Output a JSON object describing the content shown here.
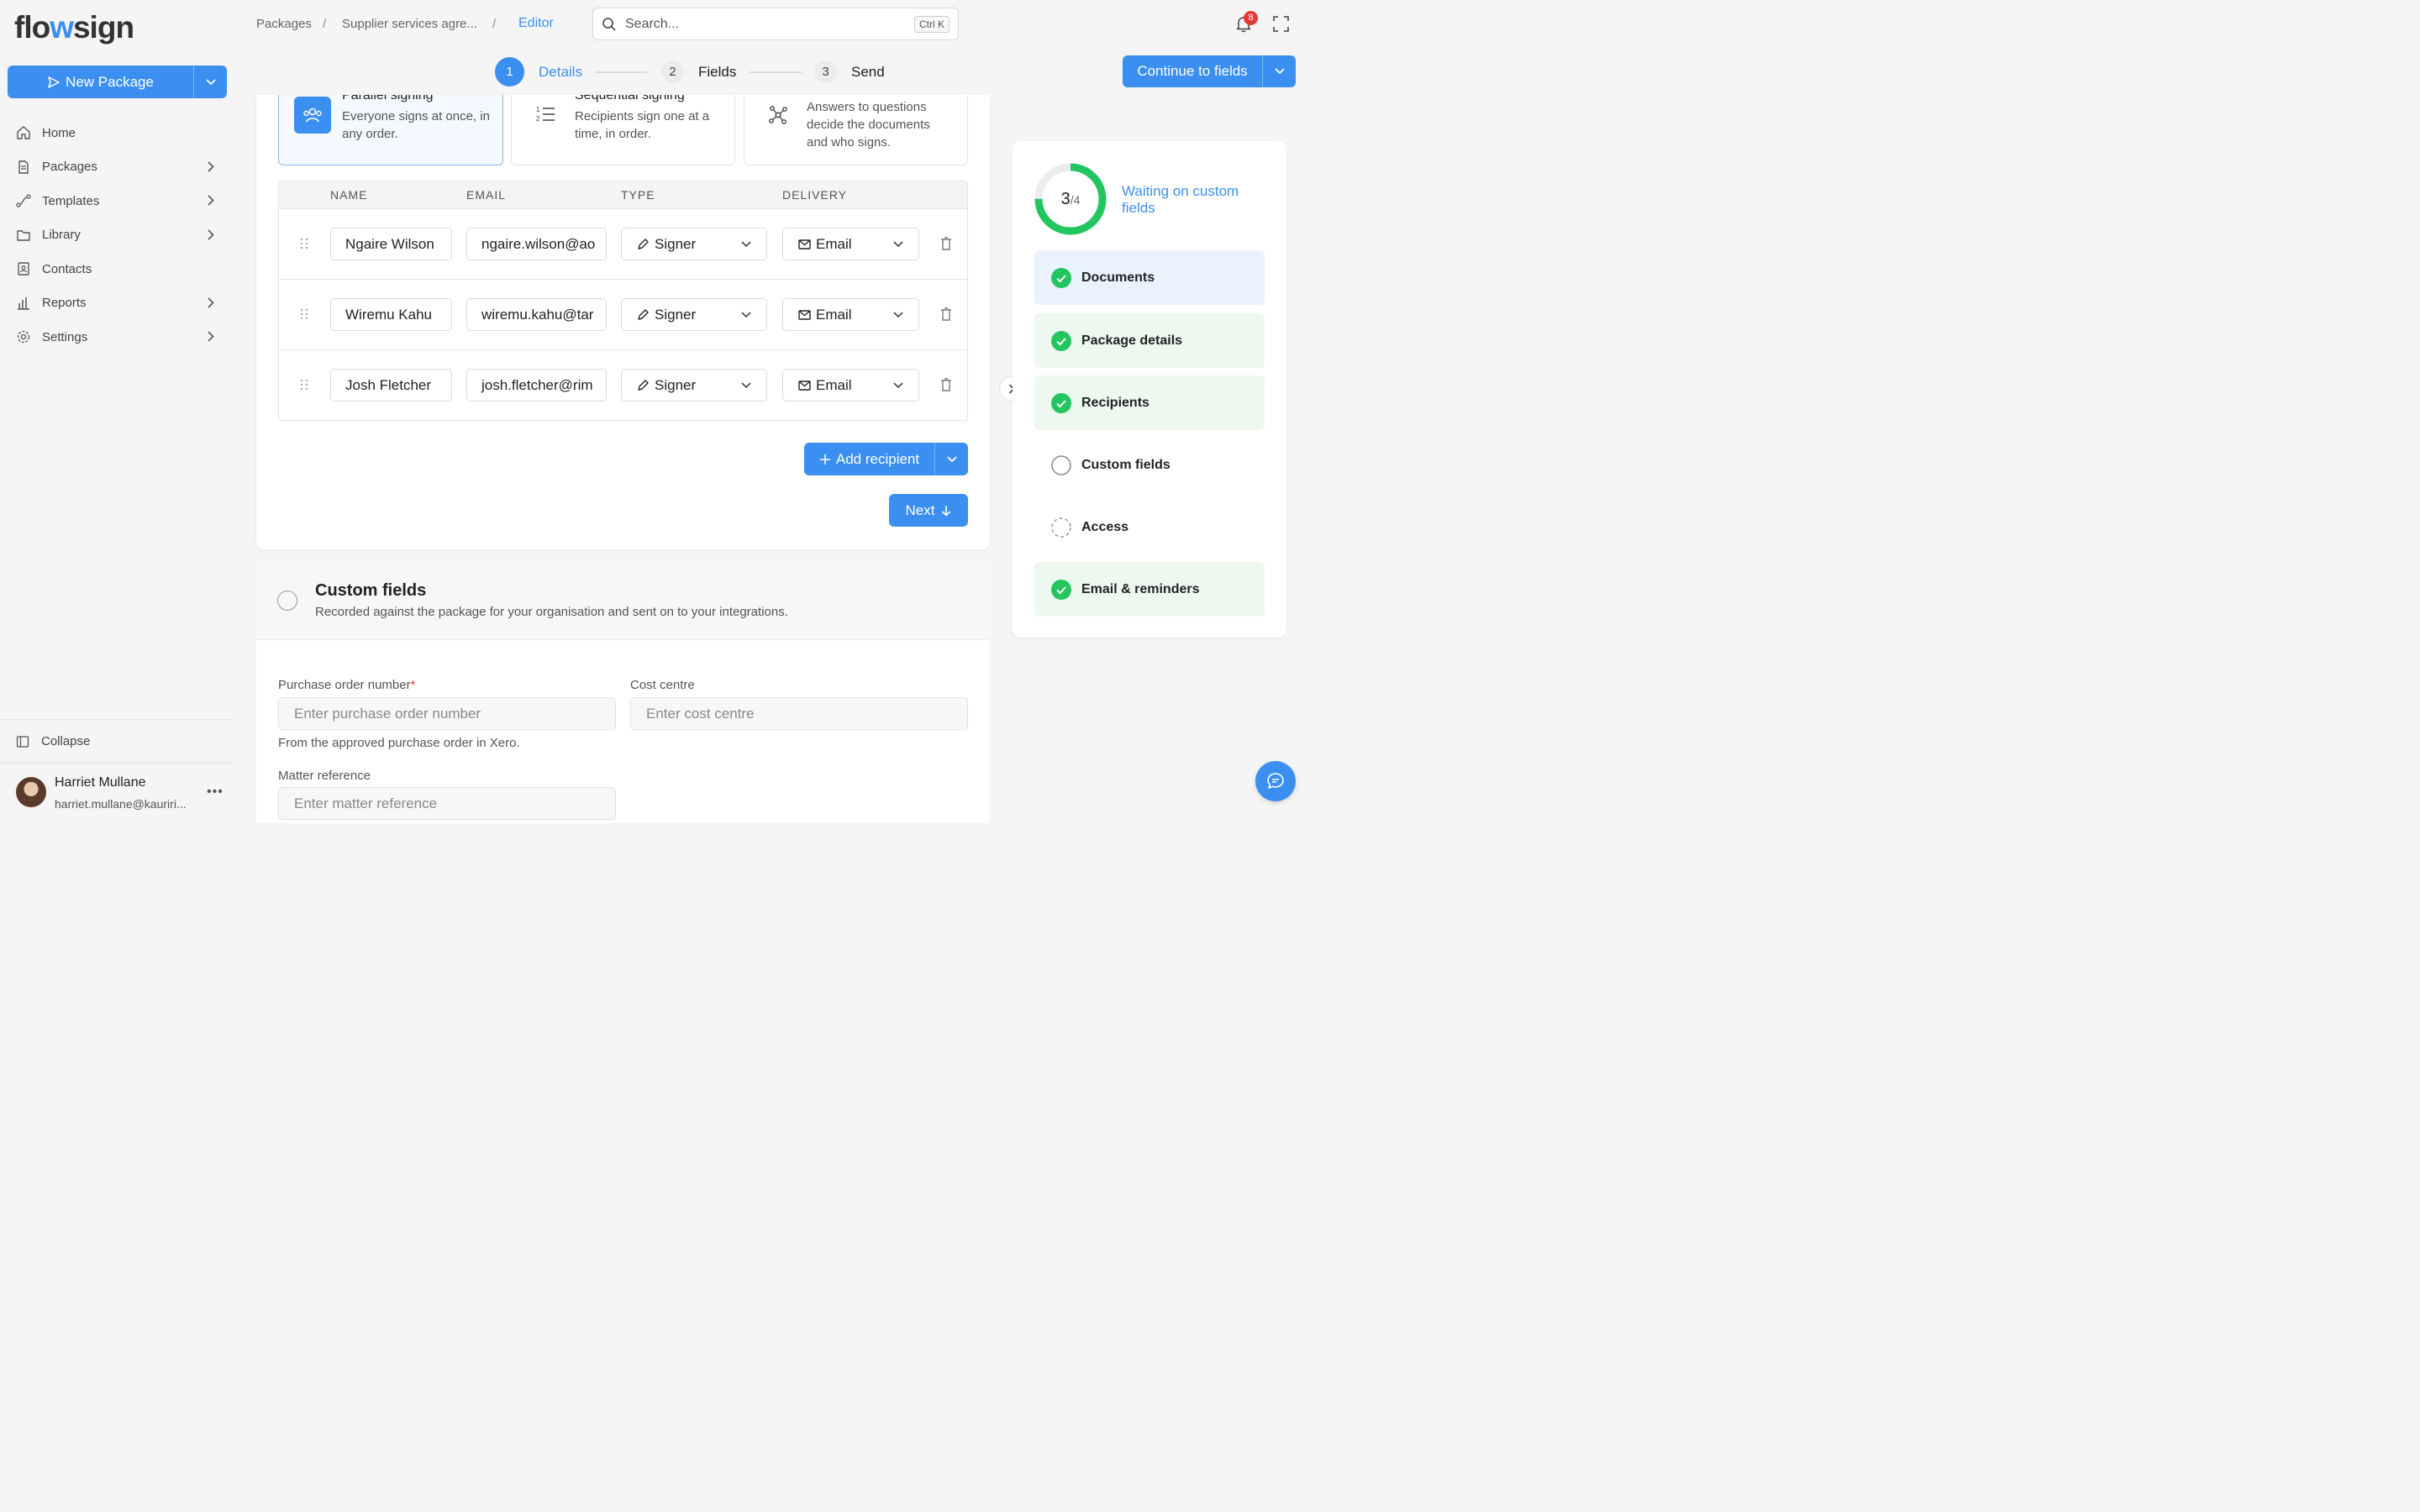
{
  "brand": {
    "logo_part1": "flo",
    "logo_part2": "w",
    "logo_part3": "sign"
  },
  "sidebar": {
    "new_package_label": "New Package",
    "items": [
      {
        "label": "Home",
        "icon": "home-icon",
        "has_children": false
      },
      {
        "label": "Packages",
        "icon": "document-icon",
        "has_children": true
      },
      {
        "label": "Templates",
        "icon": "route-icon",
        "has_children": true
      },
      {
        "label": "Library",
        "icon": "folder-icon",
        "has_children": true
      },
      {
        "label": "Contacts",
        "icon": "contact-icon",
        "has_children": false
      },
      {
        "label": "Reports",
        "icon": "bar-chart-icon",
        "has_children": true
      },
      {
        "label": "Settings",
        "icon": "gear-icon",
        "has_children": true
      }
    ],
    "collapse_label": "Collapse",
    "user": {
      "name": "Harriet Mullane",
      "email": "harriet.mullane@kauriri..."
    }
  },
  "header": {
    "breadcrumbs": [
      "Packages",
      "Supplier services agre...",
      "Editor"
    ],
    "search_placeholder": "Search...",
    "search_shortcut": "Ctrl K",
    "notification_count": "8"
  },
  "steps": [
    {
      "number": "1",
      "label": "Details",
      "active": true
    },
    {
      "number": "2",
      "label": "Fields",
      "active": false
    },
    {
      "number": "3",
      "label": "Send",
      "active": false
    }
  ],
  "continue_label": "Continue to fields",
  "signing_options": [
    {
      "title": "Parallel signing",
      "desc": "Everyone signs at once, in any order.",
      "selected": true,
      "icon": "users-icon"
    },
    {
      "title": "Sequential signing",
      "desc": "Recipients sign one at a time, in order.",
      "selected": false,
      "icon": "numbered-list-icon"
    },
    {
      "title": "",
      "desc": "Answers to questions decide the documents and who signs.",
      "selected": false,
      "icon": "nodes-icon"
    }
  ],
  "recipients_table": {
    "headers": [
      "NAME",
      "EMAIL",
      "TYPE",
      "DELIVERY"
    ],
    "rows": [
      {
        "name": "Ngaire Wilson",
        "email": "ngaire.wilson@ao",
        "type": "Signer",
        "delivery": "Email"
      },
      {
        "name": "Wiremu Kahu",
        "email": "wiremu.kahu@tar",
        "type": "Signer",
        "delivery": "Email"
      },
      {
        "name": "Josh Fletcher",
        "email": "josh.fletcher@rim",
        "type": "Signer",
        "delivery": "Email"
      }
    ]
  },
  "add_recipient_label": "Add recipient",
  "next_label": "Next",
  "custom_fields": {
    "title": "Custom fields",
    "desc": "Recorded against the package for your organisation and sent on to your integrations.",
    "po_label": "Purchase order number",
    "po_required": "*",
    "po_placeholder": "Enter purchase order number",
    "po_help": "From the approved purchase order in Xero.",
    "cost_label": "Cost centre",
    "cost_placeholder": "Enter cost centre",
    "matter_label": "Matter reference",
    "matter_placeholder": "Enter matter reference"
  },
  "progress": {
    "done": "3",
    "total": "4",
    "fraction": 0.75,
    "status": "Waiting on custom fields",
    "items": [
      {
        "label": "Documents",
        "state": "active-done"
      },
      {
        "label": "Package details",
        "state": "done"
      },
      {
        "label": "Recipients",
        "state": "done"
      },
      {
        "label": "Custom fields",
        "state": "pending"
      },
      {
        "label": "Access",
        "state": "optional"
      },
      {
        "label": "Email & reminders",
        "state": "done"
      }
    ]
  },
  "colors": {
    "accent": "#3b8ff0",
    "success": "#22c55e",
    "danger": "#e53935"
  }
}
